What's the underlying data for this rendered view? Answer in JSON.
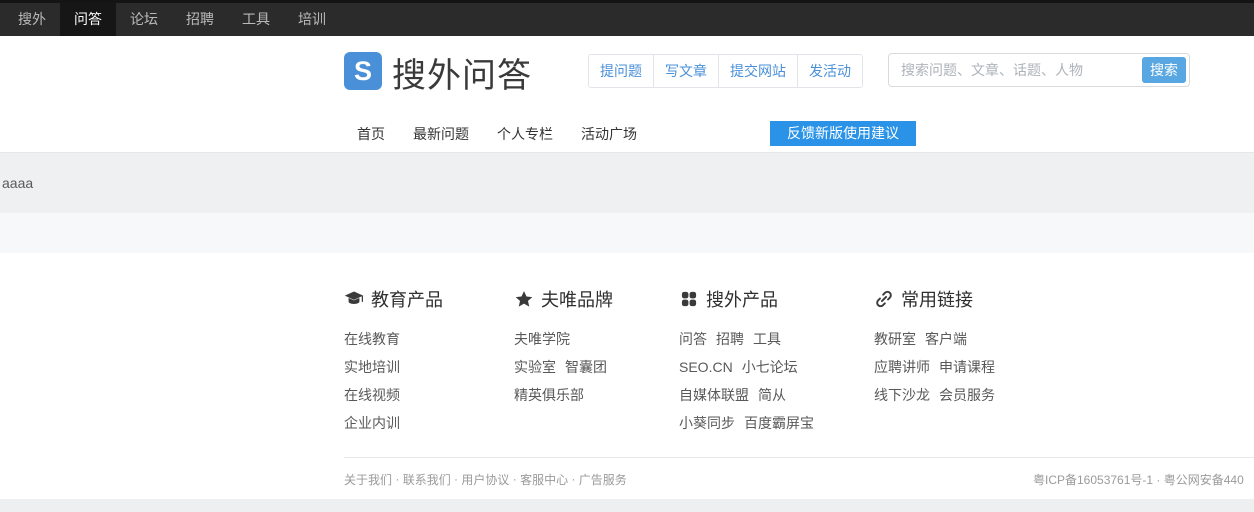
{
  "topbar": {
    "items": [
      {
        "label": "搜外",
        "active": false
      },
      {
        "label": "问答",
        "active": true
      },
      {
        "label": "论坛",
        "active": false
      },
      {
        "label": "招聘",
        "active": false
      },
      {
        "label": "工具",
        "active": false
      },
      {
        "label": "培训",
        "active": false
      }
    ]
  },
  "header": {
    "logo_letter": "S",
    "site_title": "搜外问答",
    "action_buttons": [
      "提问题",
      "写文章",
      "提交网站",
      "发活动"
    ],
    "search_placeholder": "搜索问题、文章、话题、人物",
    "search_button": "搜索"
  },
  "subnav": {
    "items": [
      "首页",
      "最新问题",
      "个人专栏",
      "活动广场"
    ],
    "feedback_button": "反馈新版使用建议"
  },
  "content": {
    "question_title": "aaaa"
  },
  "footer": {
    "columns": [
      {
        "icon": "graduation-cap-icon",
        "title": "教育产品",
        "rows": [
          [
            "在线教育"
          ],
          [
            "实地培训"
          ],
          [
            "在线视频"
          ],
          [
            "企业内训"
          ]
        ]
      },
      {
        "icon": "star-icon",
        "title": "夫唯品牌",
        "rows": [
          [
            "夫唯学院"
          ],
          [
            "实验室",
            "智囊团"
          ],
          [
            "精英俱乐部"
          ]
        ]
      },
      {
        "icon": "grid-icon",
        "title": "搜外产品",
        "rows": [
          [
            "问答",
            "招聘",
            "工具"
          ],
          [
            "SEO.CN",
            "小七论坛"
          ],
          [
            "自媒体联盟",
            "简从"
          ],
          [
            "小葵同步",
            "百度霸屏宝"
          ]
        ]
      },
      {
        "icon": "link-icon",
        "title": "常用链接",
        "rows": [
          [
            "教研室",
            "客户端"
          ],
          [
            "应聘讲师",
            "申请课程"
          ],
          [
            "线下沙龙",
            "会员服务"
          ]
        ]
      }
    ],
    "legal_links": [
      "关于我们",
      "联系我们",
      "用户协议",
      "客服中心",
      "广告服务"
    ],
    "legal_separator": " · ",
    "icp_text": "粤ICP备16053761号-1 · 粤公网安备440"
  },
  "colors": {
    "navbar_bg": "#2b2b2b",
    "navbar_active_bg": "#161616",
    "accent_blue": "#4a90d9",
    "feedback_blue": "#2a93e8",
    "search_btn_blue": "#58a7e2",
    "logo_blue": "#4a90d9",
    "band_gray": "#eef0f1",
    "band_light": "#f7f8f9"
  }
}
